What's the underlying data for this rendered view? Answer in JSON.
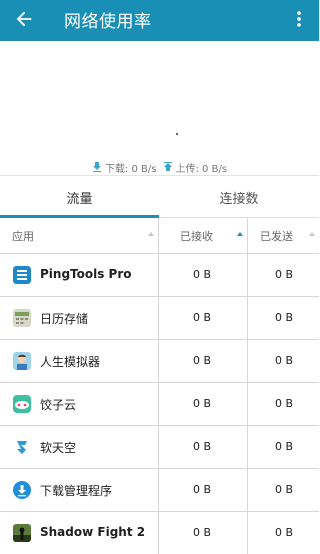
{
  "appbar": {
    "title": "网络使用率",
    "back_icon": "arrow-back-icon",
    "menu_icon": "more-vert-icon",
    "color": "#1a8fb5"
  },
  "speed": {
    "download_label": "下载: 0 B/s",
    "upload_label": "上传: 0 B/s"
  },
  "tabs": [
    {
      "label": "流量",
      "selected": true
    },
    {
      "label": "连接数",
      "selected": false
    }
  ],
  "table": {
    "headers": {
      "app": "应用",
      "received": "已接收",
      "sent": "已发送"
    },
    "sorted_by": "received",
    "rows": [
      {
        "name": "PingTools Pro",
        "received": "0 B",
        "sent": "0 B",
        "icon": "pingtools-icon"
      },
      {
        "name": "日历存储",
        "received": "0 B",
        "sent": "0 B",
        "icon": "calendar-storage-icon"
      },
      {
        "name": "人生模拟器",
        "received": "0 B",
        "sent": "0 B",
        "icon": "life-simulator-icon"
      },
      {
        "name": "饺子云",
        "received": "0 B",
        "sent": "0 B",
        "icon": "dumpling-cloud-icon"
      },
      {
        "name": "软天空",
        "received": "0 B",
        "sent": "0 B",
        "icon": "soft-sky-icon"
      },
      {
        "name": "下载管理程序",
        "received": "0 B",
        "sent": "0 B",
        "icon": "download-manager-icon"
      },
      {
        "name": "Shadow Fight 2",
        "received": "0 B",
        "sent": "0 B",
        "icon": "shadow-fight-icon"
      }
    ]
  }
}
